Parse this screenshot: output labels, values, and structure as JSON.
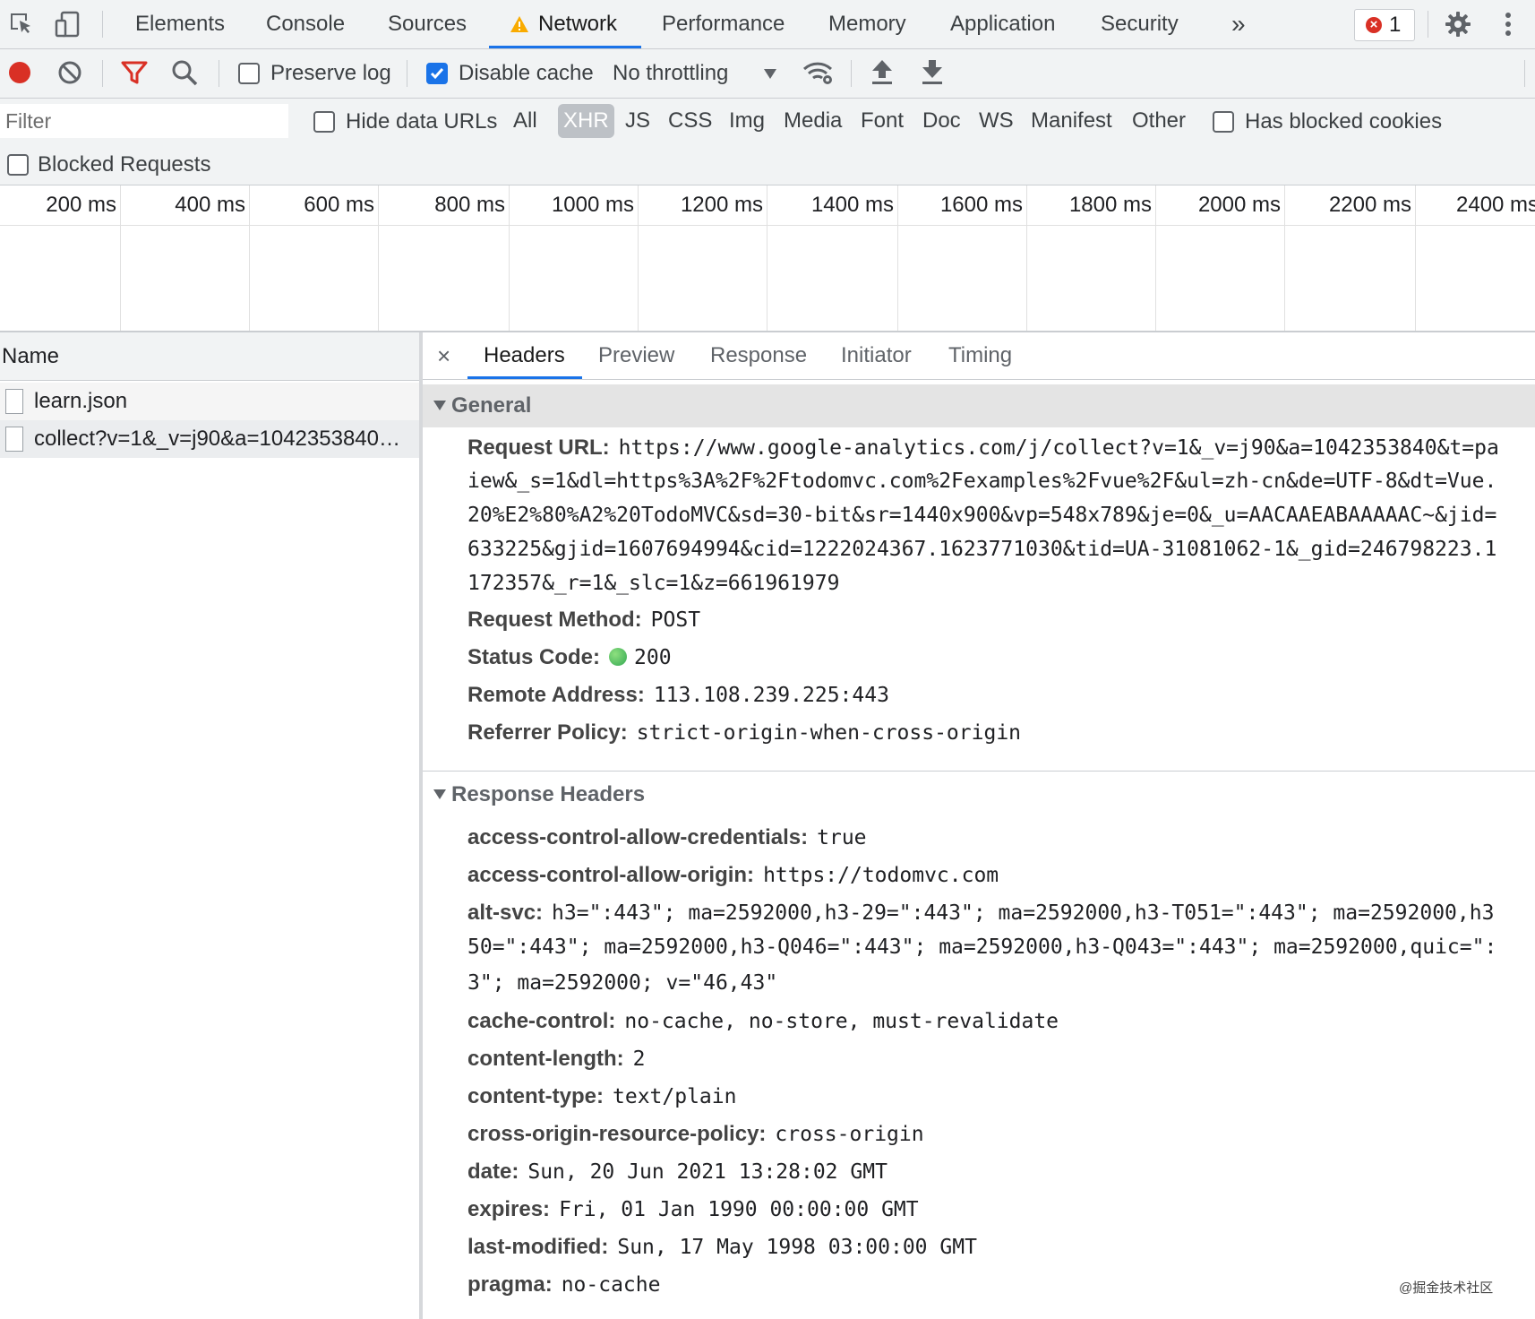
{
  "tabs": {
    "items": [
      "Elements",
      "Console",
      "Sources",
      "Network",
      "Performance",
      "Memory",
      "Application",
      "Security"
    ],
    "more": "»",
    "error_count": "1"
  },
  "toolbar": {
    "preserve_log": "Preserve log",
    "disable_cache": "Disable cache",
    "throttling": "No throttling"
  },
  "filter": {
    "placeholder": "Filter",
    "hide_data_urls": "Hide data URLs",
    "types": [
      "All",
      "XHR",
      "JS",
      "CSS",
      "Img",
      "Media",
      "Font",
      "Doc",
      "WS",
      "Manifest",
      "Other"
    ],
    "selected_type": "XHR",
    "has_blocked_cookies": "Has blocked cookies",
    "blocked_requests": "Blocked Requests"
  },
  "timeline": {
    "ticks": [
      "200 ms",
      "400 ms",
      "600 ms",
      "800 ms",
      "1000 ms",
      "1200 ms",
      "1400 ms",
      "1600 ms",
      "1800 ms",
      "2000 ms",
      "2200 ms",
      "2400 ms"
    ]
  },
  "requests": {
    "header": "Name",
    "items": [
      "learn.json",
      "collect?v=1&_v=j90&a=1042353840…"
    ]
  },
  "details": {
    "close": "×",
    "tabs": [
      "Headers",
      "Preview",
      "Response",
      "Initiator",
      "Timing"
    ],
    "general": {
      "title": "General",
      "request_url_label": "Request URL:",
      "request_url_lines": [
        "https://www.google-analytics.com/j/collect?v=1&_v=j90&a=1042353840&t=pa",
        "iew&_s=1&dl=https%3A%2F%2Ftodomvc.com%2Fexamples%2Fvue%2F&ul=zh-cn&de=UTF-8&dt=Vue.",
        "20%E2%80%A2%20TodoMVC&sd=30-bit&sr=1440x900&vp=548x789&je=0&_u=AACAAEABAAAAAC~&jid=",
        "633225&gjid=1607694994&cid=1222024367.1623771030&tid=UA-31081062-1&_gid=246798223.1",
        "172357&_r=1&_slc=1&z=661961979"
      ],
      "method_label": "Request Method:",
      "method": "POST",
      "status_label": "Status Code:",
      "status": "200",
      "remote_label": "Remote Address:",
      "remote": "113.108.239.225:443",
      "referrer_label": "Referrer Policy:",
      "referrer": "strict-origin-when-cross-origin"
    },
    "response": {
      "title": "Response Headers",
      "acac_label": "access-control-allow-credentials:",
      "acac": "true",
      "acao_label": "access-control-allow-origin:",
      "acao": "https://todomvc.com",
      "altsvc_label": "alt-svc:",
      "altsvc_lines": [
        "h3=\":443\"; ma=2592000,h3-29=\":443\"; ma=2592000,h3-T051=\":443\"; ma=2592000,h3",
        "50=\":443\"; ma=2592000,h3-Q046=\":443\"; ma=2592000,h3-Q043=\":443\"; ma=2592000,quic=\":",
        "3\"; ma=2592000; v=\"46,43\""
      ],
      "cc_label": "cache-control:",
      "cc": "no-cache, no-store, must-revalidate",
      "cl_label": "content-length:",
      "cl": "2",
      "ct_label": "content-type:",
      "ct": "text/plain",
      "corp_label": "cross-origin-resource-policy:",
      "corp": "cross-origin",
      "date_label": "date:",
      "date": "Sun, 20 Jun 2021 13:28:02 GMT",
      "expires_label": "expires:",
      "expires": "Fri, 01 Jan 1990 00:00:00 GMT",
      "lm_label": "last-modified:",
      "lm": "Sun, 17 May 1998 03:00:00 GMT",
      "pragma_label": "pragma:",
      "pragma": "no-cache"
    }
  },
  "watermark": "@掘金技术社区",
  "colors": {
    "accent": "#1a73e8",
    "record": "#d93025",
    "warning": "#f9ab00",
    "status_ok": "#34a853"
  }
}
